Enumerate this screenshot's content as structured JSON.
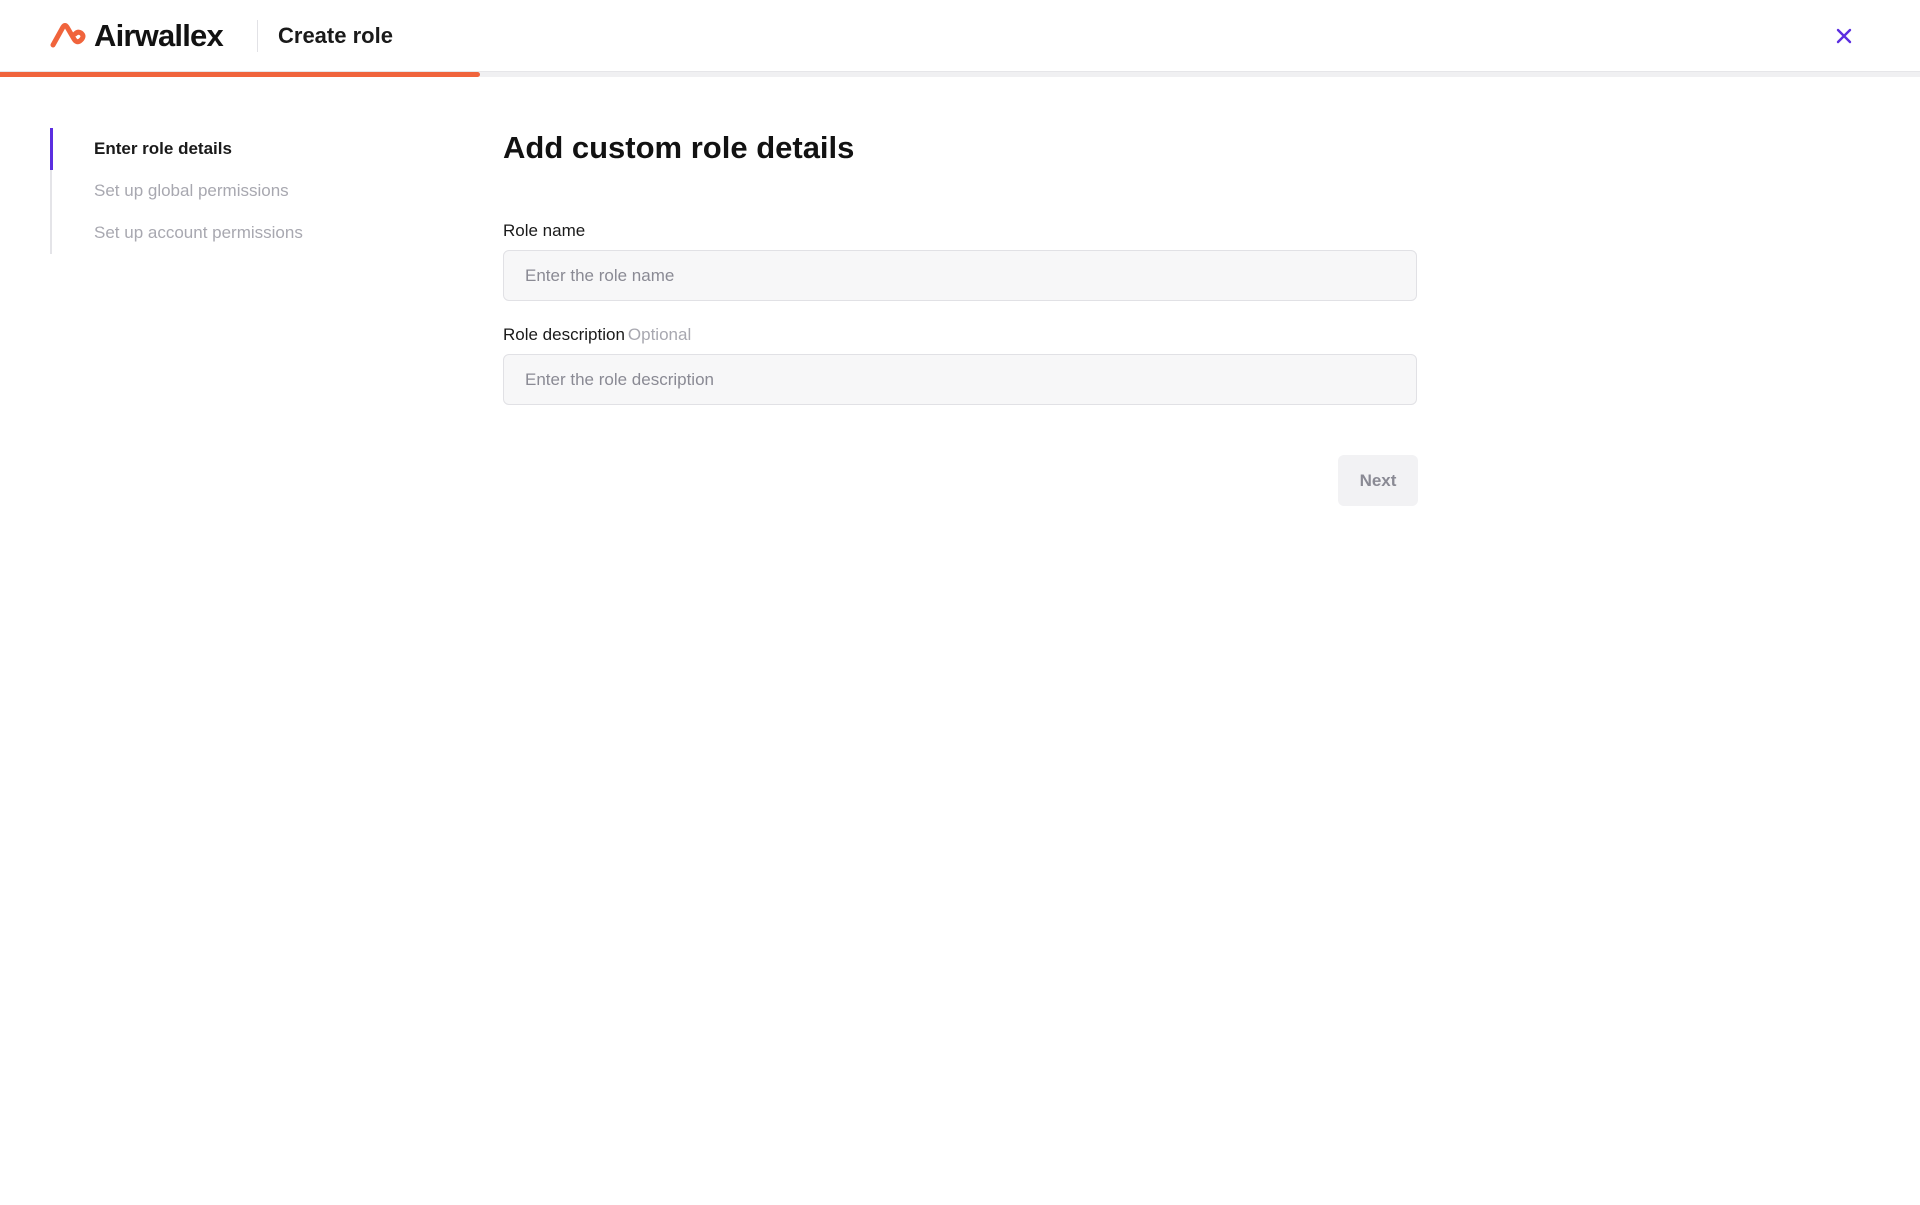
{
  "header": {
    "brand_name": "Airwallex",
    "title": "Create role",
    "close_icon": "close-icon",
    "accent_color": "#f0643c",
    "close_color": "#5b2ee0"
  },
  "progress": {
    "fraction": 0.25
  },
  "stepper": {
    "steps": [
      {
        "label": "Enter role details",
        "state": "active"
      },
      {
        "label": "Set up global permissions",
        "state": "upcoming"
      },
      {
        "label": "Set up account permissions",
        "state": "upcoming"
      }
    ],
    "active_color": "#5b2ee0"
  },
  "form": {
    "title": "Add custom role details",
    "role_name": {
      "label": "Role name",
      "value": "",
      "placeholder": "Enter the role name"
    },
    "role_description": {
      "label": "Role description",
      "optional_label": "Optional",
      "value": "",
      "placeholder": "Enter the role description"
    },
    "next_label": "Next",
    "next_disabled": true
  }
}
